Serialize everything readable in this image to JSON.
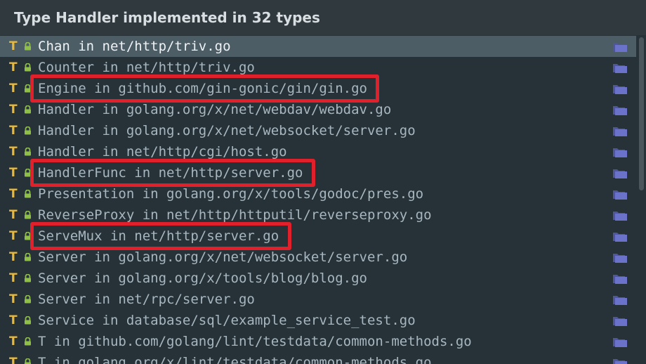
{
  "popup": {
    "title": "Type Handler implemented in 32 types"
  },
  "items": [
    {
      "kind": "T",
      "label": "Chan in net/http/triv.go",
      "selected": true
    },
    {
      "kind": "T",
      "label": "Counter in net/http/triv.go"
    },
    {
      "kind": "T",
      "label": "Engine in github.com/gin-gonic/gin/gin.go",
      "highlighted": true
    },
    {
      "kind": "T",
      "label": "Handler in golang.org/x/net/webdav/webdav.go"
    },
    {
      "kind": "T",
      "label": "Handler in golang.org/x/net/websocket/server.go"
    },
    {
      "kind": "T",
      "label": "Handler in net/http/cgi/host.go"
    },
    {
      "kind": "T",
      "label": "HandlerFunc in net/http/server.go",
      "highlighted": true
    },
    {
      "kind": "T",
      "label": "Presentation in golang.org/x/tools/godoc/pres.go"
    },
    {
      "kind": "T",
      "label": "ReverseProxy in net/http/httputil/reverseproxy.go"
    },
    {
      "kind": "T",
      "label": "ServeMux in net/http/server.go",
      "highlighted": true
    },
    {
      "kind": "T",
      "label": "Server in golang.org/x/net/websocket/server.go"
    },
    {
      "kind": "T",
      "label": "Server in golang.org/x/tools/blog/blog.go"
    },
    {
      "kind": "T",
      "label": "Server in net/rpc/server.go"
    },
    {
      "kind": "T",
      "label": "Service in database/sql/example_service_test.go"
    },
    {
      "kind": "T",
      "label": "T in github.com/golang/lint/testdata/common-methods.go"
    },
    {
      "kind": "T",
      "label": "T in golang.org/x/lint/testdata/common-methods.go"
    }
  ],
  "icons": {
    "kind_color": "#e8b83a",
    "lock_icon": "lock-icon",
    "lock_color": "#8fbf4a",
    "folder_icon": "folder-icon",
    "folder_color": "#6b72c9",
    "highlight_color": "#e0202a"
  }
}
